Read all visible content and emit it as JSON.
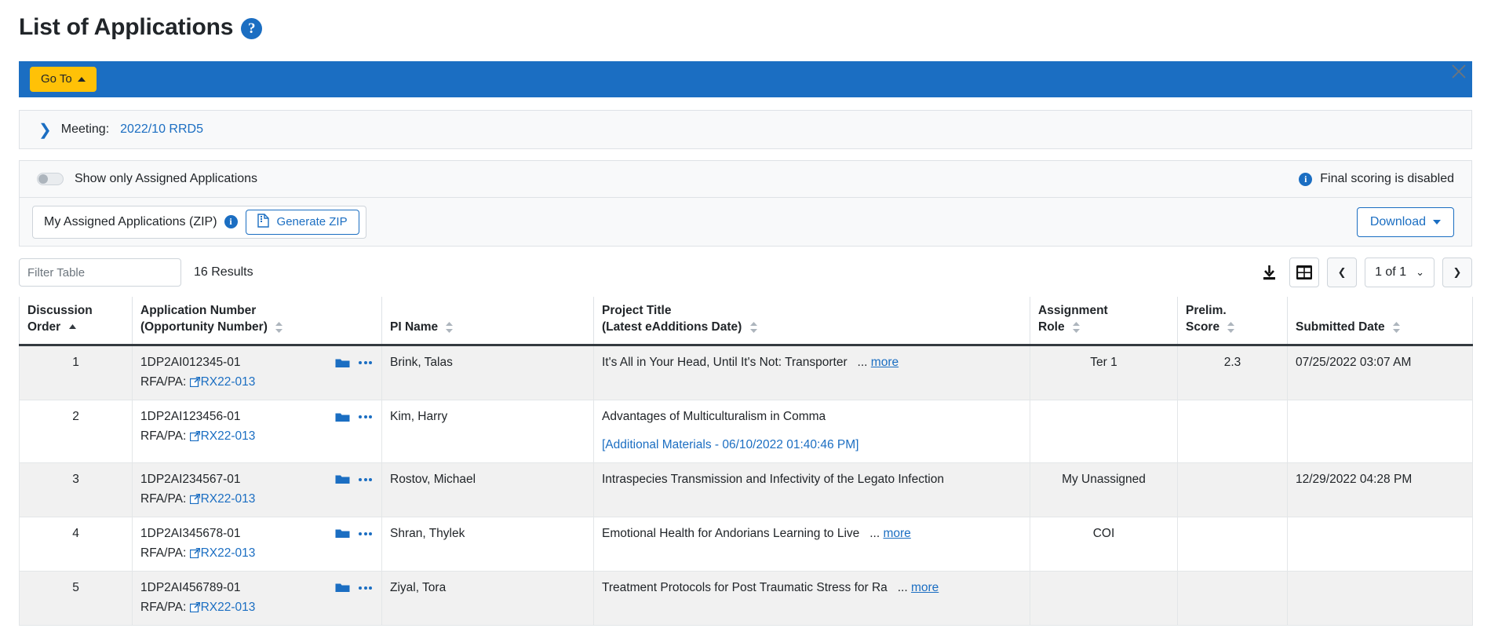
{
  "header": {
    "title": "List of Applications",
    "help_icon": "help-circle-icon",
    "close_icon": "close-icon"
  },
  "toolbar": {
    "goto_label": "Go To"
  },
  "meeting": {
    "label": "Meeting:",
    "value": "2022/10 RRD5",
    "expand_icon": "chevron-right-icon"
  },
  "options": {
    "toggle_label": "Show only Assigned Applications",
    "toggle_state": "off",
    "scoring_note": "Final scoring is disabled",
    "scoring_info_icon": "info-icon"
  },
  "zip": {
    "label": "My Assigned Applications (ZIP)",
    "info_icon": "info-icon",
    "generate_label": "Generate ZIP",
    "generate_icon": "zip-file-icon",
    "download_label": "Download"
  },
  "filter": {
    "placeholder": "Filter Table",
    "value": "",
    "results": "16 Results",
    "export_icon": "download-tray-icon",
    "columns_icon": "table-grid-icon",
    "prev_icon": "chevron-left-icon",
    "next_icon": "chevron-right-icon",
    "page_label": "1 of 1"
  },
  "table": {
    "columns": [
      {
        "line1": "Discussion",
        "line2": "Order",
        "sort": "asc"
      },
      {
        "line1": "Application Number",
        "line2": "(Opportunity Number)",
        "sort": "none"
      },
      {
        "line1": "",
        "line2": "PI Name",
        "sort": "none"
      },
      {
        "line1": "Project Title",
        "line2": "(Latest eAdditions Date)",
        "sort": "none"
      },
      {
        "line1": "Assignment",
        "line2": "Role",
        "sort": "none"
      },
      {
        "line1": "Prelim.",
        "line2": "Score",
        "sort": "none"
      },
      {
        "line1": "",
        "line2": "Submitted Date",
        "sort": "none"
      }
    ],
    "rows": [
      {
        "order": "1",
        "app_number": "1DP2AI012345-01",
        "rfa_label": "RFA/PA:",
        "rfa_value": "RX22-013",
        "pi_name": "Brink, Talas",
        "title": "It's All in Your Head, Until It's Not: Transporter",
        "title_truncated": true,
        "more_label": "more",
        "additional_materials": "",
        "assignment_role": "Ter 1",
        "prelim_score": "2.3",
        "submitted_date": "07/25/2022 03:07 AM"
      },
      {
        "order": "2",
        "app_number": "1DP2AI123456-01",
        "rfa_label": "RFA/PA:",
        "rfa_value": "RX22-013",
        "pi_name": "Kim, Harry",
        "title": "Advantages of Multiculturalism in Comma",
        "title_truncated": false,
        "more_label": "",
        "additional_materials": "[Additional Materials - 06/10/2022 01:40:46 PM]",
        "assignment_role": "",
        "prelim_score": "",
        "submitted_date": ""
      },
      {
        "order": "3",
        "app_number": "1DP2AI234567-01",
        "rfa_label": "RFA/PA:",
        "rfa_value": "RX22-013",
        "pi_name": "Rostov, Michael",
        "title": "Intraspecies Transmission and Infectivity of the Legato Infection",
        "title_truncated": false,
        "more_label": "",
        "additional_materials": "",
        "assignment_role": "My Unassigned",
        "prelim_score": "",
        "submitted_date": "12/29/2022 04:28 PM"
      },
      {
        "order": "4",
        "app_number": "1DP2AI345678-01",
        "rfa_label": "RFA/PA:",
        "rfa_value": "RX22-013",
        "pi_name": "Shran, Thylek",
        "title": "Emotional Health for Andorians Learning to Live",
        "title_truncated": true,
        "more_label": "more",
        "additional_materials": "",
        "assignment_role": "COI",
        "prelim_score": "",
        "submitted_date": ""
      },
      {
        "order": "5",
        "app_number": "1DP2AI456789-01",
        "rfa_label": "RFA/PA:",
        "rfa_value": "RX22-013",
        "pi_name": "Ziyal, Tora",
        "title": "Treatment Protocols for Post Traumatic Stress for Ra",
        "title_truncated": true,
        "more_label": "more",
        "additional_materials": "",
        "assignment_role": "",
        "prelim_score": "",
        "submitted_date": ""
      }
    ]
  },
  "colors": {
    "primary": "#1b6ec2",
    "accent": "#ffc107",
    "text": "#212529",
    "panel_bg": "#f8f9fa",
    "row_alt": "#f1f1f1"
  }
}
